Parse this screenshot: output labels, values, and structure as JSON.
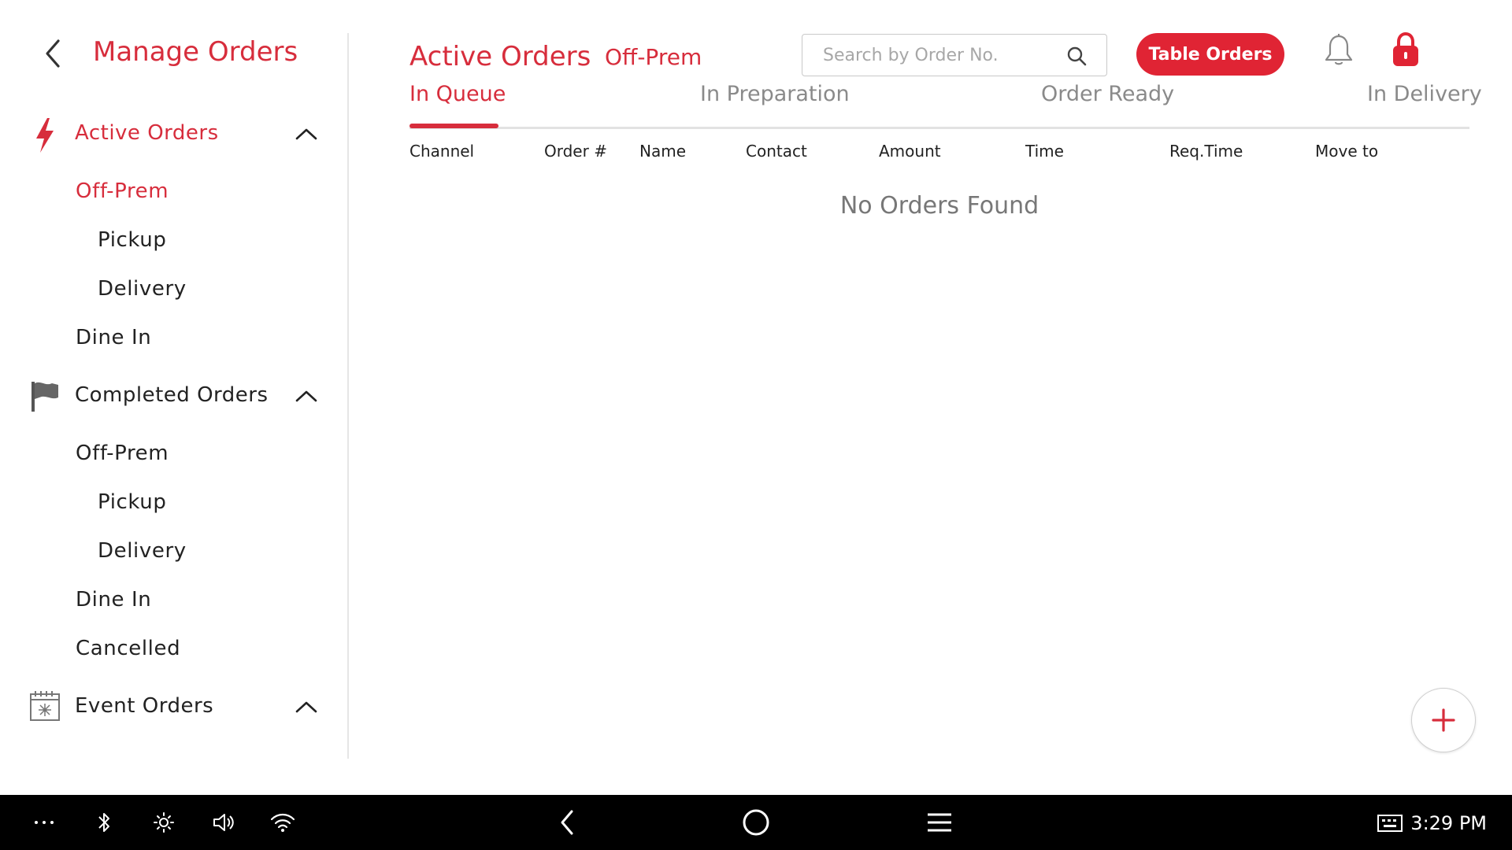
{
  "sidebar": {
    "title": "Manage Orders",
    "sections": [
      {
        "label": "Active Orders",
        "icon": "lightning-icon",
        "items": [
          {
            "label": "Off-Prem"
          },
          {
            "label": "Pickup"
          },
          {
            "label": "Delivery"
          },
          {
            "label": "Dine In"
          }
        ]
      },
      {
        "label": "Completed Orders",
        "icon": "flag-icon",
        "items": [
          {
            "label": "Off-Prem"
          },
          {
            "label": "Pickup"
          },
          {
            "label": "Delivery"
          },
          {
            "label": "Dine In"
          },
          {
            "label": "Cancelled"
          }
        ]
      },
      {
        "label": "Event Orders",
        "icon": "calendar-icon",
        "items": []
      }
    ]
  },
  "header": {
    "title": "Active Orders",
    "subtitle": "Off-Prem",
    "search_placeholder": "Search by Order No.",
    "table_orders_label": "Table Orders"
  },
  "tabs": [
    {
      "label": "In Queue",
      "active": true
    },
    {
      "label": "In Preparation",
      "active": false
    },
    {
      "label": "Order Ready",
      "active": false
    },
    {
      "label": "In Delivery",
      "active": false
    }
  ],
  "table": {
    "columns": [
      "Channel",
      "Order #",
      "Name",
      "Contact",
      "Amount",
      "Time",
      "Req.Time",
      "Move to"
    ],
    "empty_message": "No Orders Found"
  },
  "status_bar": {
    "time": "3:29 PM"
  },
  "colors": {
    "accent": "#d72d3c",
    "button": "#e02434"
  }
}
